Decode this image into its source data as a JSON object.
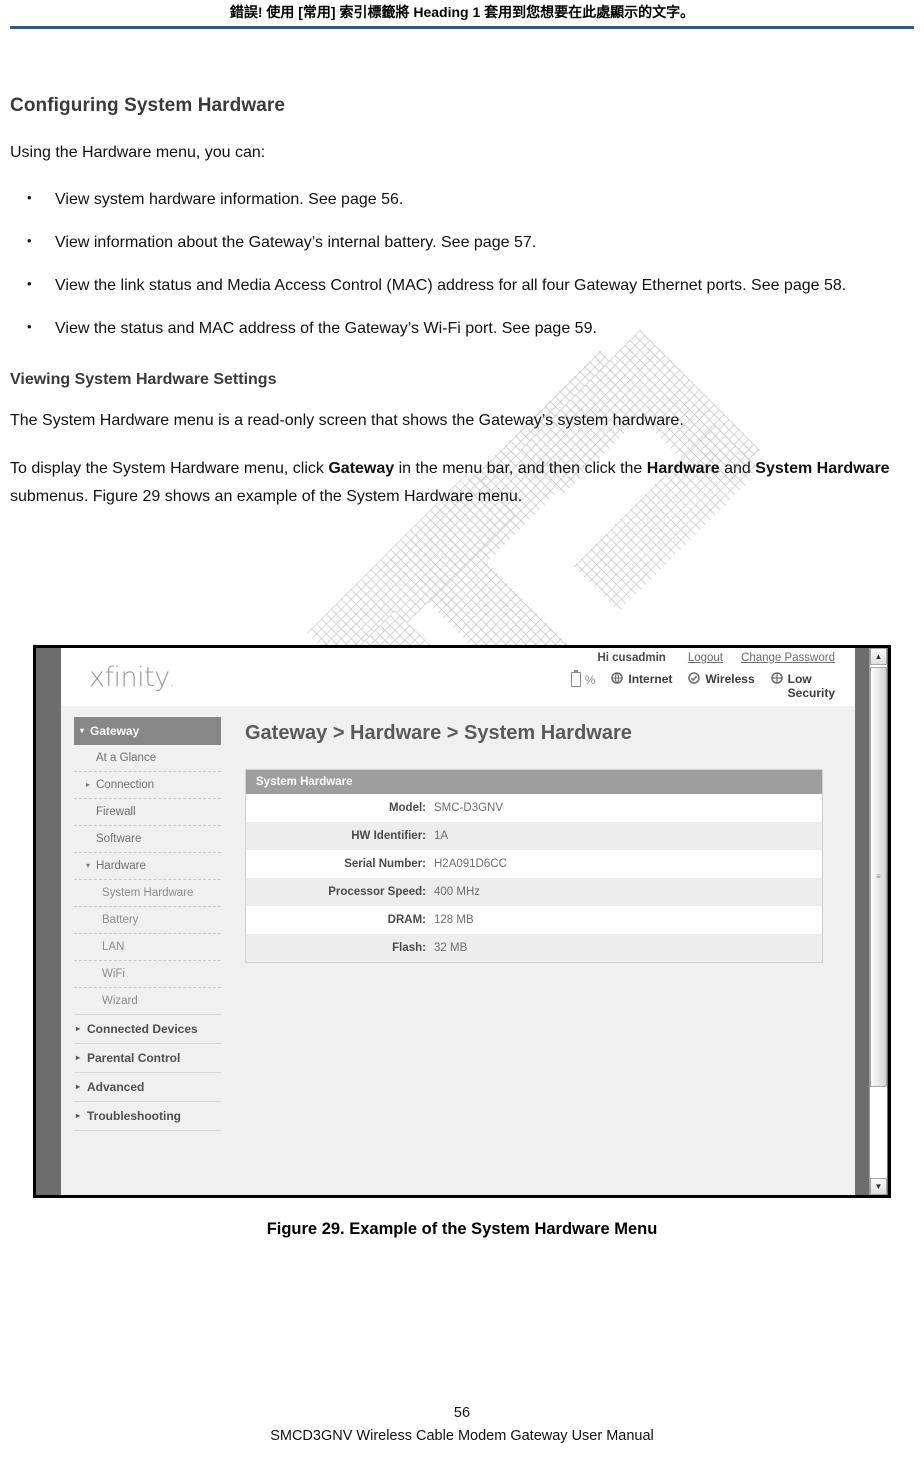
{
  "header": {
    "error_notice": "錯誤! 使用 [常用] 索引標籤將 Heading 1 套用到您想要在此處顯示的文字。",
    "rule_color": "#2e5a86"
  },
  "content": {
    "section_title": "Configuring System Hardware",
    "intro": "Using the Hardware menu, you can:",
    "bullets": [
      "View system hardware information. See page 56.",
      "View information about the Gateway’s internal battery. See page 57.",
      "View the link status and Media Access Control (MAC) address for all four Gateway Ethernet ports. See page 58.",
      "View the status and MAC address of the Gateway’s Wi-Fi port. See page 59."
    ],
    "sub_title": "Viewing System Hardware Settings",
    "para1": "The System Hardware menu is a read-only screen that shows the Gateway’s system hardware.",
    "para2": {
      "t1": "To display the System Hardware menu, click ",
      "b1": "Gateway",
      "t2": " in the menu bar, and then click the ",
      "b2": "Hardware",
      "t3": " and ",
      "b3": "System Hardware",
      "t4": " submenus. Figure 29 shows an example of the System Hardware menu."
    }
  },
  "screenshot": {
    "logo": "xfinity",
    "account": {
      "greeting": "Hi cusadmin",
      "logout": "Logout",
      "change_password": "Change Password"
    },
    "status": {
      "battery_percent": "%",
      "internet": "Internet",
      "wireless": "Wireless",
      "security_line1": "Low",
      "security_line2": "Security"
    },
    "sidebar": [
      {
        "label": "Gateway",
        "level": "top",
        "caret": "▾"
      },
      {
        "label": "At a Glance",
        "level": "sub",
        "caret": ""
      },
      {
        "label": "Connection",
        "level": "sub",
        "caret": "▸"
      },
      {
        "label": "Firewall",
        "level": "sub",
        "caret": ""
      },
      {
        "label": "Software",
        "level": "sub",
        "caret": ""
      },
      {
        "label": "Hardware",
        "level": "sub",
        "caret": "▾"
      },
      {
        "label": "System Hardware",
        "level": "sub2",
        "caret": ""
      },
      {
        "label": "Battery",
        "level": "sub2",
        "caret": ""
      },
      {
        "label": "LAN",
        "level": "sub2",
        "caret": ""
      },
      {
        "label": "WiFi",
        "level": "sub2",
        "caret": ""
      },
      {
        "label": "Wizard",
        "level": "sub2",
        "caret": ""
      },
      {
        "label": "Connected Devices",
        "level": "group",
        "caret": "▸"
      },
      {
        "label": "Parental Control",
        "level": "group",
        "caret": "▸"
      },
      {
        "label": "Advanced",
        "level": "group",
        "caret": "▸"
      },
      {
        "label": "Troubleshooting",
        "level": "group",
        "caret": "▸"
      }
    ],
    "breadcrumb": "Gateway > Hardware > System Hardware",
    "panel": {
      "title": "System Hardware",
      "rows": [
        {
          "key": "Model:",
          "value": "SMC-D3GNV"
        },
        {
          "key": "HW Identifier:",
          "value": "1A"
        },
        {
          "key": "Serial Number:",
          "value": "H2A091D6CC"
        },
        {
          "key": "Processor Speed:",
          "value": "400 MHz"
        },
        {
          "key": "DRAM:",
          "value": "128 MB"
        },
        {
          "key": "Flash:",
          "value": "32 MB"
        }
      ]
    },
    "scrollbar": {
      "up": "▲",
      "down": "▼",
      "grip": "≡"
    }
  },
  "figure_caption": "Figure 29. Example of the System Hardware Menu",
  "footer": {
    "page_number": "56",
    "manual_title": "SMCD3GNV Wireless Cable Modem Gateway User Manual"
  }
}
